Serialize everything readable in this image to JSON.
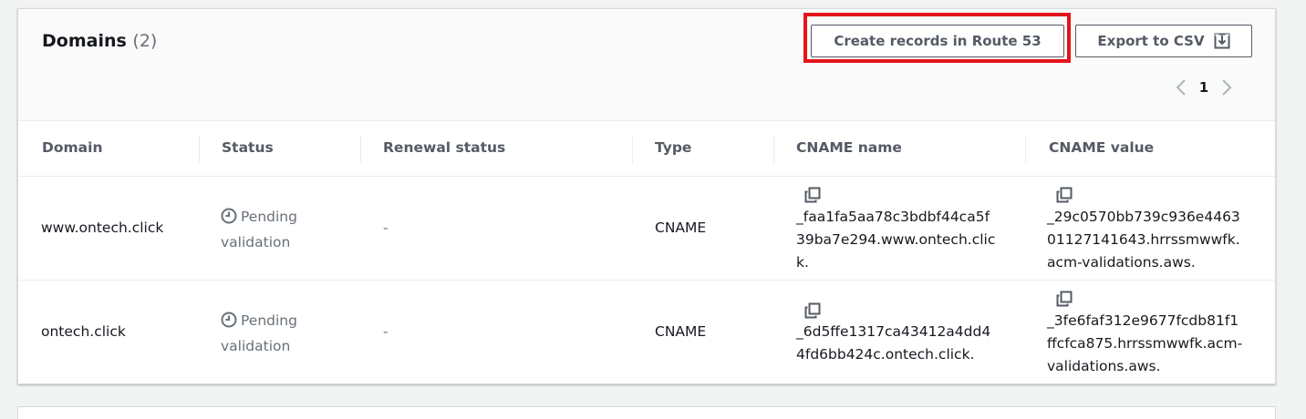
{
  "header": {
    "title": "Domains",
    "count": "(2)"
  },
  "toolbar": {
    "create_records_label": "Create records in Route 53",
    "export_csv_label": "Export to CSV",
    "export_icon": "download-icon"
  },
  "pagination": {
    "current_page": "1",
    "prev_icon": "chevron-left-icon",
    "next_icon": "chevron-right-icon"
  },
  "table": {
    "columns": [
      "Domain",
      "Status",
      "Renewal status",
      "Type",
      "CNAME name",
      "CNAME value"
    ],
    "rows": [
      {
        "domain": "www.ontech.click",
        "status_line1": "Pending",
        "status_line2": "validation",
        "renewal_status": "-",
        "type": "CNAME",
        "cname_name": [
          "_faa1fa5aa78c3bdbf44ca5f",
          "39ba7e294.www.ontech.clic",
          "k."
        ],
        "cname_value": [
          "_29c0570bb739c936e4463",
          "01127141643.hrrssmwwfk.",
          "acm-validations.aws."
        ]
      },
      {
        "domain": "ontech.click",
        "status_line1": "Pending",
        "status_line2": "validation",
        "renewal_status": "-",
        "type": "CNAME",
        "cname_name": [
          "_6d5ffe1317ca43412a4dd4",
          "4fd6bb424c.ontech.click."
        ],
        "cname_value": [
          "_3fe6faf312e9677fcdb81f1",
          "ffcfca875.hrrssmwwfk.acm-",
          "validations.aws."
        ]
      }
    ]
  },
  "colors": {
    "highlight": "#e3151a",
    "button_border": "#545b64",
    "status_pending": "#687078"
  }
}
